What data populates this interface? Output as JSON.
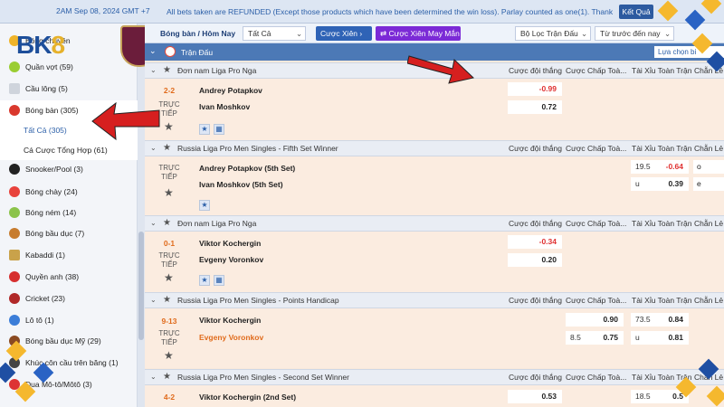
{
  "topbar": {
    "clock": "2AM Sep 08, 2024 GMT +7",
    "notice": "All bets taken are REFUNDED (Except those products which have been determined the win loss). Parlay counted as one(1). Thank",
    "result_btn": "Kết Quả"
  },
  "logo": {
    "brand_a": "BK",
    "brand_b": "8"
  },
  "filter": {
    "sport_title": "Bóng bàn / Hôm Nay",
    "select_all": "Tất Cả",
    "parlay_btn": "Cược Xiên",
    "lucky_btn": "Cược Xiên May Mắn",
    "dd_filter": "Bộ Lọc Trận Đấu",
    "dd_sort": "Từ trước đến nay"
  },
  "market_header": {
    "label": "Trận Đấu",
    "choose": "Lựa chọn bi"
  },
  "sidebar": {
    "items": [
      {
        "label": "Bóng chuyền",
        "count": ""
      },
      {
        "label": "Quần vợt",
        "count": "(59)"
      },
      {
        "label": "Cầu lông",
        "count": "(5)"
      },
      {
        "label": "Bóng bàn",
        "count": "(305)"
      },
      {
        "label": "Tất Cả",
        "count": "(305)"
      },
      {
        "label": "Cá Cược Tổng Hợp",
        "count": "(61)"
      },
      {
        "label": "Snooker/Pool",
        "count": "(3)"
      },
      {
        "label": "Bóng chày",
        "count": "(24)"
      },
      {
        "label": "Bóng ném",
        "count": "(14)"
      },
      {
        "label": "Bóng bầu dục",
        "count": "(7)"
      },
      {
        "label": "Kabaddi",
        "count": "(1)"
      },
      {
        "label": "Quyền anh",
        "count": "(38)"
      },
      {
        "label": "Cricket",
        "count": "(23)"
      },
      {
        "label": "Lô tô",
        "count": "(1)"
      },
      {
        "label": "Bóng bầu dục Mỹ",
        "count": "(29)"
      },
      {
        "label": "Khúc côn cầu trên băng",
        "count": "(1)"
      },
      {
        "label": "Đua Mô-tô/Môtô",
        "count": "(3)"
      }
    ]
  },
  "columns": {
    "win": "Cược đội thắng",
    "handicap": "Cược Chấp Toà...",
    "ou": "Tài Xỉu Toàn Trận",
    "oddeven": "Chẵn Lẻ"
  },
  "leagues": [
    {
      "name": "Đơn nam Liga Pro Nga",
      "score": "2-2",
      "live": "TRỰC TIẾP",
      "team1": "Andrey Potapkov",
      "team2": "Ivan Moshkov",
      "odd1": "-0.99",
      "odd2": "0.72"
    },
    {
      "name": "Russia Liga Pro Men Singles - Fifth Set Winner",
      "live": "TRỰC TIẾP",
      "team1": "Andrey Potapkov (5th Set)",
      "team2": "Ivan Moshkov (5th Set)",
      "ou_line": "19.5",
      "ou_over": "-0.64",
      "ou_u": "u",
      "ou_under": "0.39",
      "oe_o": "o",
      "oe_e": "e"
    },
    {
      "name": "Đơn nam Liga Pro Nga",
      "score": "0-1",
      "live": "TRỰC TIẾP",
      "team1": "Viktor Kochergin",
      "team2": "Evgeny Voronkov",
      "odd1": "-0.34",
      "odd2": "0.20"
    },
    {
      "name": "Russia Liga Pro Men Singles - Points Handicap",
      "score": "9-13",
      "live": "TRỰC TIẾP",
      "team1": "Viktor Kochergin",
      "team2": "Evgeny Voronkov",
      "hc1": "0.90",
      "hc_line": "8.5",
      "hc2": "0.75",
      "ou_line": "73.5",
      "ou_over": "0.84",
      "ou_u": "u",
      "ou_under": "0.81"
    },
    {
      "name": "Russia Liga Pro Men Singles - Second Set Winner",
      "score": "4-2",
      "team1": "Viktor Kochergin (2nd Set)",
      "odd1": "0.53",
      "ou_line": "18.5",
      "ou_over": "0.5"
    }
  ]
}
